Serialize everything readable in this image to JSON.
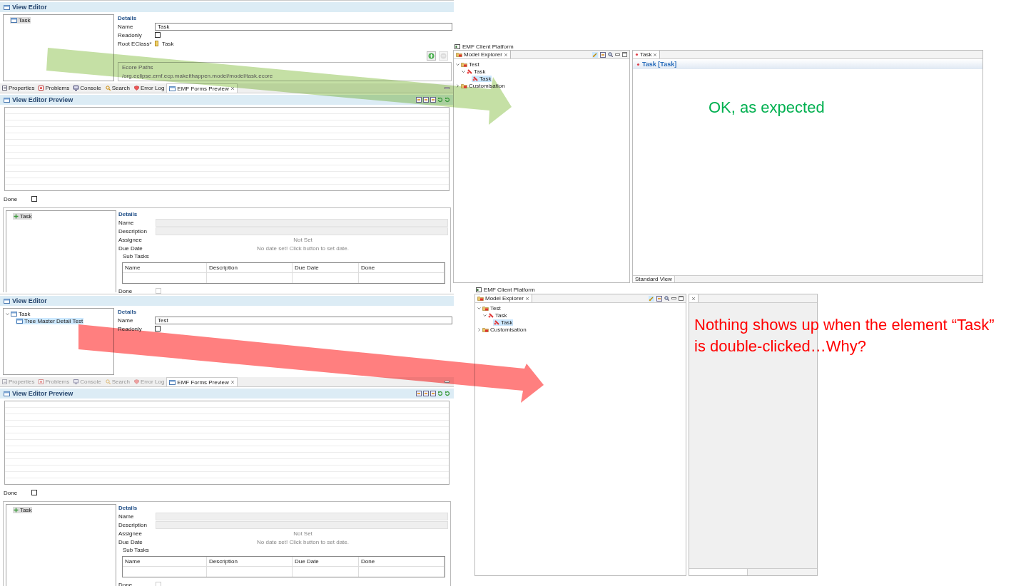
{
  "screens": [
    {
      "kind": "designer",
      "editor": {
        "title": "View Editor",
        "tree_focused": false,
        "tree": [
          {
            "label": "Task",
            "kind": "view",
            "selected": true
          }
        ],
        "details_title": "Details",
        "fields": [
          {
            "kind": "text",
            "label": "Name",
            "value": "Task"
          },
          {
            "kind": "checkbox",
            "label": "Readonly",
            "checked": false
          },
          {
            "kind": "reference",
            "label": "Root EClass*",
            "value": "Task"
          }
        ],
        "ecore_paths": {
          "buttons": [
            {
              "kind": "add",
              "disabled": false
            },
            {
              "kind": "remove",
              "disabled": true
            }
          ],
          "title": "Ecore Paths",
          "paths": [
            "/org.eclipse.emf.ecp.makeithappen.model/model/task.ecore"
          ]
        }
      },
      "tabs": [
        {
          "label": "Properties",
          "selected": false,
          "disabled": false
        },
        {
          "label": "Problems",
          "selected": false,
          "disabled": false
        },
        {
          "label": "Console",
          "selected": false,
          "disabled": false
        },
        {
          "label": "Search",
          "selected": false,
          "disabled": false
        },
        {
          "label": "Error Log",
          "selected": false,
          "disabled": false
        },
        {
          "label": "EMF Forms Preview",
          "selected": true,
          "disabled": false
        }
      ],
      "preview": {
        "title": "View Editor Preview",
        "done": {
          "label": "Done",
          "checked": false
        },
        "tree_focused": false,
        "tree": [
          {
            "label": "Task",
            "kind": "task",
            "selected": true
          }
        ],
        "details_title": "Details",
        "fields": [
          {
            "kind": "text",
            "label": "Name",
            "disabled": true
          },
          {
            "kind": "text",
            "label": "Description",
            "disabled": true
          },
          {
            "kind": "info",
            "label": "Assignee",
            "value": "Not Set"
          },
          {
            "kind": "info",
            "label": "Due Date",
            "value": "No date set! Click button to set date."
          }
        ],
        "subtable": {
          "label": "Sub Tasks",
          "columns": [
            "Name",
            "Description",
            "Due Date",
            "Done"
          ]
        },
        "bottom_field": {
          "label": "Done",
          "checked": false,
          "disabled": true
        }
      }
    },
    {
      "kind": "designer",
      "editor": {
        "title": "View Editor",
        "tree_focused": true,
        "tree": [
          {
            "label": "Task",
            "kind": "view",
            "expanded": true,
            "selected": false,
            "children": [
              {
                "label": "Tree Master Detail Test",
                "kind": "view",
                "selected": true
              }
            ]
          }
        ],
        "details_title": "Details",
        "fields": [
          {
            "kind": "text",
            "label": "Name",
            "value": "Test"
          },
          {
            "kind": "checkbox",
            "label": "Readonly",
            "checked": false
          }
        ]
      },
      "tabs": [
        {
          "label": "Properties",
          "selected": false,
          "disabled": true
        },
        {
          "label": "Problems",
          "selected": false,
          "disabled": true
        },
        {
          "label": "Console",
          "selected": false,
          "disabled": true
        },
        {
          "label": "Search",
          "selected": false,
          "disabled": true
        },
        {
          "label": "Error Log",
          "selected": false,
          "disabled": true
        },
        {
          "label": "EMF Forms Preview",
          "selected": true,
          "disabled": false
        }
      ],
      "preview": {
        "title": "View Editor Preview",
        "done": {
          "label": "Done",
          "checked": false
        },
        "tree_focused": false,
        "tree": [
          {
            "label": "Task",
            "kind": "task",
            "selected": true
          }
        ],
        "details_title": "Details",
        "fields": [
          {
            "kind": "text",
            "label": "Name",
            "disabled": true
          },
          {
            "kind": "text",
            "label": "Description",
            "disabled": true
          },
          {
            "kind": "info",
            "label": "Assignee",
            "value": "Not Set"
          },
          {
            "kind": "info",
            "label": "Due Date",
            "value": "No date set! Click button to set date."
          }
        ],
        "subtable": {
          "label": "Sub Tasks",
          "columns": [
            "Name",
            "Description",
            "Due Date",
            "Done"
          ]
        },
        "bottom_field": {
          "label": "Done",
          "checked": false,
          "disabled": true
        }
      }
    },
    {
      "kind": "client",
      "title": "EMF Client Platform",
      "explorer": {
        "title": "Model Explorer",
        "tree": [
          {
            "label": "Test",
            "kind": "project",
            "expanded": true,
            "selected": false,
            "children": [
              {
                "label": "Task",
                "kind": "element",
                "expanded": true,
                "selected": false,
                "children": [
                  {
                    "label": "Task",
                    "kind": "element",
                    "selected": true
                  }
                ]
              }
            ]
          },
          {
            "label": "Customisation",
            "kind": "project",
            "expanded": false,
            "selected": false
          }
        ]
      },
      "editor": {
        "open": true,
        "tab": "Task",
        "heading": "Task [Task]",
        "bottom_tab": "Standard View"
      }
    },
    {
      "kind": "client",
      "title": "EMF Client Platform",
      "explorer": {
        "title": "Model Explorer",
        "tree": [
          {
            "label": "Test",
            "kind": "project",
            "expanded": true,
            "selected": false,
            "children": [
              {
                "label": "Task",
                "kind": "element",
                "expanded": true,
                "selected": false,
                "children": [
                  {
                    "label": "Task",
                    "kind": "element",
                    "selected": true
                  }
                ]
              }
            ]
          },
          {
            "label": "Customisation",
            "kind": "project",
            "expanded": false,
            "selected": false
          }
        ]
      },
      "editor": {
        "open": false
      }
    }
  ],
  "arrows": [
    {
      "color": "#c5e0a5"
    },
    {
      "color": "#ff7f7f"
    }
  ],
  "notes": [
    {
      "text": "OK, as expected",
      "color": "#00b050"
    },
    {
      "text": "Nothing shows up when the element “Task” is double-clicked…Why?",
      "color": "#ff0000"
    }
  ]
}
